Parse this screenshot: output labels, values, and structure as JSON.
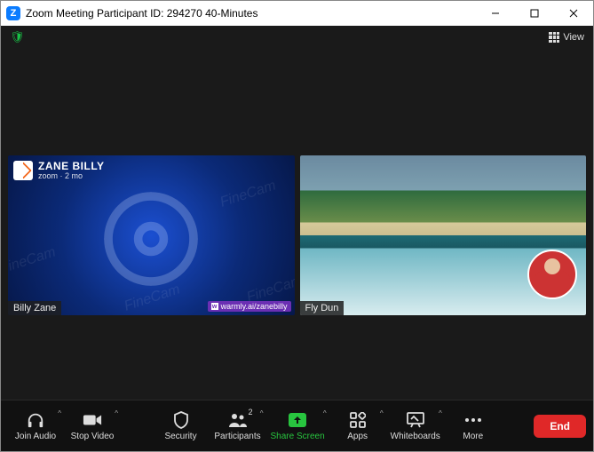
{
  "window": {
    "title": "Zoom Meeting Participant ID: 294270   40-Minutes"
  },
  "topbar": {
    "view_label": "View"
  },
  "tiles": [
    {
      "name": "Billy Zane",
      "overlay_title": "ZANE BILLY",
      "overlay_sub": "zoom · 2 mo",
      "watermark": "FineCam",
      "badge": "warmly.ai/zanebilly"
    },
    {
      "name": "Fly Dun"
    }
  ],
  "toolbar": {
    "join_audio": "Join Audio",
    "stop_video": "Stop Video",
    "security": "Security",
    "participants": "Participants",
    "participants_count": "2",
    "share_screen": "Share Screen",
    "apps": "Apps",
    "whiteboards": "Whiteboards",
    "more": "More",
    "end": "End"
  }
}
